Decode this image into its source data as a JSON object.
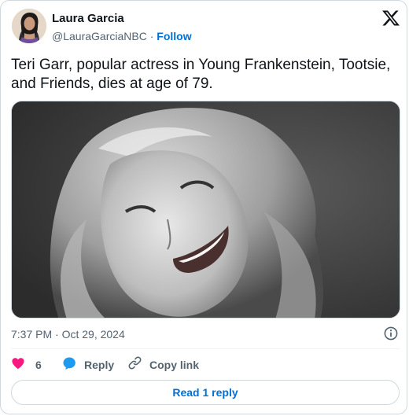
{
  "author": {
    "name": "Laura Garcia",
    "handle": "@LauraGarciaNBC",
    "separator": " · ",
    "follow_label": "Follow"
  },
  "tweet": {
    "text": "Teri Garr, popular actress in Young Frankenstein, Tootsie, and Friends, dies at age of 79.",
    "timestamp": "7:37 PM · Oct 29, 2024"
  },
  "actions": {
    "like_count": "6",
    "reply_label": "Reply",
    "copy_link_label": "Copy link"
  },
  "read_replies_label": "Read 1 reply",
  "icons": {
    "x_logo": "x-logo-icon",
    "info": "info-icon",
    "heart": "heart-icon",
    "reply": "reply-bubble-icon",
    "link": "link-icon"
  },
  "colors": {
    "link_blue": "#006fd6",
    "heart_pink": "#f91880",
    "reply_blue": "#1d9bf0",
    "secondary_text": "#536471",
    "border": "#cfd9de"
  }
}
